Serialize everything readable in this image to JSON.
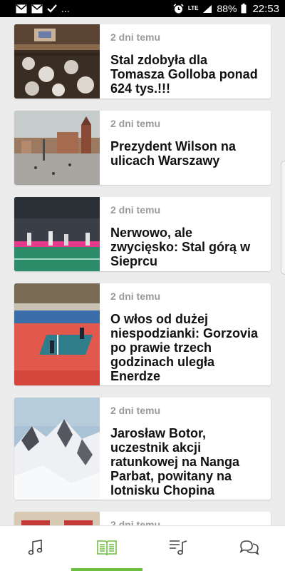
{
  "status_bar": {
    "left_icons": [
      "mail-icon",
      "mail-icon",
      "check-icon",
      "more-icon"
    ],
    "more_text": "...",
    "right_icons": [
      "alarm-icon",
      "lte-icon",
      "signal-icon",
      "battery-icon"
    ],
    "lte_label": "LTE",
    "battery": "88%",
    "time": "22:53"
  },
  "colors": {
    "accent": "#6dbf3f",
    "date_text": "#9a9a9a",
    "title_text": "#111111",
    "background": "#ececec"
  },
  "articles": [
    {
      "date": "2 dni temu",
      "title": "Stal zdobyła dla Tomasza Golloba ponad 624 tys.!!!"
    },
    {
      "date": "2 dni temu",
      "title": "Prezydent Wilson na ulicach Warszawy"
    },
    {
      "date": "2 dni temu",
      "title": "Nerwowo, ale zwycięsko: Stal górą w Sieprcu"
    },
    {
      "date": "2 dni temu",
      "title": "O włos od dużej niespodzianki: Gorzovia po prawie trzech godzinach uległa Enerdze"
    },
    {
      "date": "2 dni temu",
      "title": "Jarosław Botor, uczestnik akcji ratunkowej na Nanga Parbat, powitany na lotnisku Chopina"
    },
    {
      "date": "2 dni temu",
      "title": ""
    }
  ],
  "bottom_nav": {
    "items": [
      {
        "icon": "music-note-icon",
        "active": false
      },
      {
        "icon": "news-icon",
        "active": true
      },
      {
        "icon": "playlist-icon",
        "active": false
      },
      {
        "icon": "chat-icon",
        "active": false
      }
    ]
  }
}
